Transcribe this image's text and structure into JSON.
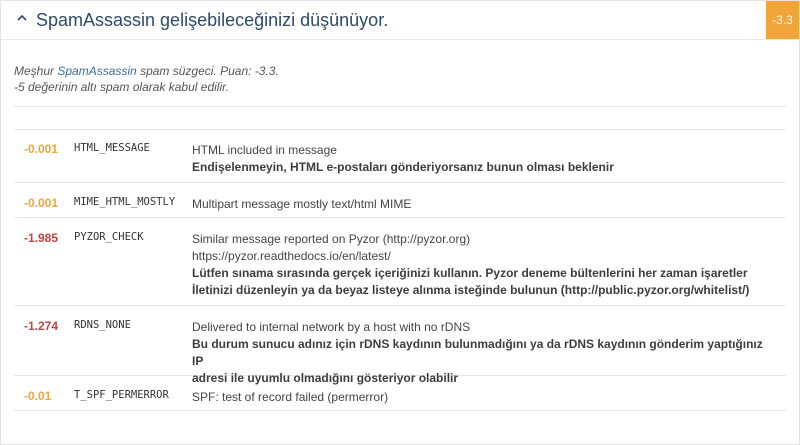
{
  "header": {
    "title": "SpamAssassin gelişebileceğinizi düşünüyor.",
    "score": "-3.3",
    "badge_color": "#f0a43a"
  },
  "intro": {
    "prefix": "Meşhur ",
    "link": "SpamAssassin",
    "suffix": " spam süzgeci. Puan: -3.3.",
    "line2": "-5 değerinin altı spam olarak kabul edilir."
  },
  "colors": {
    "orange": "#f0a43a",
    "red": "#c0453a"
  },
  "rules": [
    {
      "score": "-0.001",
      "name": "HTML_MESSAGE",
      "desc": [
        "HTML included in message"
      ],
      "tip": [
        "Endişelenmeyin, HTML e-postaları gönderiyorsanız bunun olması beklenir"
      ]
    },
    {
      "score": "-0.001",
      "name": "MIME_HTML_MOSTLY",
      "desc": [
        "Multipart message mostly text/html MIME"
      ],
      "tip": []
    },
    {
      "score": "-1.985",
      "name": "PYZOR_CHECK",
      "desc": [
        "Similar message reported on Pyzor (http://pyzor.org)",
        "https://pyzor.readthedocs.io/en/latest/"
      ],
      "tip": [
        "Lütfen sınama sırasında gerçek içeriğinizi kullanın. Pyzor deneme bültenlerini her zaman işaretler",
        "İletinizi düzenleyin ya da beyaz listeye alınma isteğinde bulunun (http://public.pyzor.org/whitelist/)"
      ]
    },
    {
      "score": "-1.274",
      "name": "RDNS_NONE",
      "desc": [
        "Delivered to internal network by a host with no rDNS"
      ],
      "tip": [
        "Bu durum sunucu adınız için rDNS kaydının bulunmadığını ya da rDNS kaydının gönderim yaptığınız IP",
        "adresi ile uyumlu olmadığını gösteriyor olabilir"
      ]
    },
    {
      "score": "-0.01",
      "name": "T_SPF_PERMERROR",
      "desc": [
        "SPF: test of record failed (permerror)"
      ],
      "tip": []
    }
  ]
}
